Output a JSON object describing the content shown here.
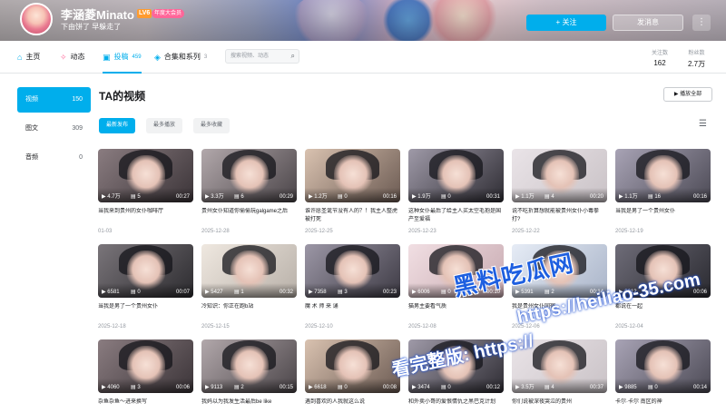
{
  "header": {
    "username": "李涵菱Minato",
    "level": "LV6",
    "badge": "年度大会员",
    "signature": "下由饼了 早躲走了",
    "follow_label": "+ 关注",
    "message_label": "发消息",
    "more_label": "⋮"
  },
  "nav": {
    "tabs": [
      {
        "label": "主页",
        "icon": "home-icon",
        "count": ""
      },
      {
        "label": "动态",
        "icon": "dynamic-icon",
        "count": ""
      },
      {
        "label": "投稿",
        "icon": "tv-icon",
        "count": "459"
      },
      {
        "label": "合集和系列",
        "icon": "collection-icon",
        "count": "3"
      }
    ],
    "search_placeholder": "搜索视频、动态",
    "stats": [
      {
        "label": "关注数",
        "value": "162"
      },
      {
        "label": "粉丝数",
        "value": "2.7万"
      }
    ]
  },
  "sidebar": {
    "items": [
      {
        "label": "视频",
        "count": "150"
      },
      {
        "label": "图文",
        "count": "309"
      },
      {
        "label": "音频",
        "count": "0"
      }
    ]
  },
  "main": {
    "title": "TA的视频",
    "play_all_label": "▶ 播放全部",
    "sort_tabs": [
      "最新发布",
      "最多播放",
      "最多收藏"
    ]
  },
  "videos": [
    {
      "views": "4.7万",
      "likes": "5",
      "duration": "00:27",
      "title": "当我来到贵州的女仆咖啡厅",
      "date": "01-03"
    },
    {
      "views": "3.3万",
      "likes": "6",
      "duration": "00:29",
      "title": "贵州女仆知道你偷偷玩galgame之后",
      "date": "2025-12-28"
    },
    {
      "views": "1.2万",
      "likes": "0",
      "duration": "00:16",
      "title": "谁许愿圣诞节没有人的？！我主人整虎被打死",
      "date": "2025-12-25"
    },
    {
      "views": "1.9万",
      "likes": "0",
      "duration": "00:31",
      "title": "这种女仆最后了给主人买太空毛抱是国产至爱福",
      "date": "2025-12-23"
    },
    {
      "views": "1.1万",
      "likes": "4",
      "duration": "00:20",
      "title": "说不吃折算想就能被贵州女仆小毒拳打?",
      "date": "2025-12-22"
    },
    {
      "views": "1.1万",
      "likes": "16",
      "duration": "00:16",
      "title": "当我是男了一个贵州女仆",
      "date": "2025-12-19"
    },
    {
      "views": "6581",
      "likes": "0",
      "duration": "00:07",
      "title": "当我是男了一个贵州女仆",
      "date": "2025-12-18"
    },
    {
      "views": "5427",
      "likes": "1",
      "duration": "00:32",
      "title": "冷知识：你正在跑b站",
      "date": "2025-12-15"
    },
    {
      "views": "7358",
      "likes": "3",
      "duration": "00:23",
      "title": "魔 术 师 来 诵",
      "date": "2025-12-10"
    },
    {
      "views": "6006",
      "likes": "0",
      "duration": "00:10",
      "title": "猫男主要看气质",
      "date": "2025-12-08"
    },
    {
      "views": "5391",
      "likes": "2",
      "duration": "00:14",
      "title": "我是贵州女仆同宿",
      "date": "2025-12-06"
    },
    {
      "views": "3012",
      "likes": "0",
      "duration": "00:06",
      "title": "都说在一起",
      "date": "2025-12-04"
    },
    {
      "views": "4060",
      "likes": "3",
      "duration": "00:06",
      "title": "杂鱼杂鱼～进来换写",
      "date": ""
    },
    {
      "views": "9113",
      "likes": "2",
      "duration": "00:15",
      "title": "我妈以为我发生活最后be like",
      "date": ""
    },
    {
      "views": "6618",
      "likes": "0",
      "duration": "00:08",
      "title": "遇到喜欢的人我就这么说",
      "date": ""
    },
    {
      "views": "3474",
      "likes": "0",
      "duration": "00:12",
      "title": "和外卖小哥的爱恨情仇之黑巴克计划",
      "date": ""
    },
    {
      "views": "3.5万",
      "likes": "4",
      "duration": "00:37",
      "title": "你们说被深夜哭泣的贵州",
      "date": ""
    },
    {
      "views": "9885",
      "likes": "0",
      "duration": "00:14",
      "title": "卡尔·卡尔 南区的神",
      "date": ""
    }
  ],
  "watermark": {
    "line1": "黑料吃瓜网",
    "line2": "https://heiliao-35.com",
    "line3": "看完整版: https://"
  },
  "colors": {
    "accent": "#00aeec",
    "text": "#18191c",
    "muted": "#9499a0"
  }
}
